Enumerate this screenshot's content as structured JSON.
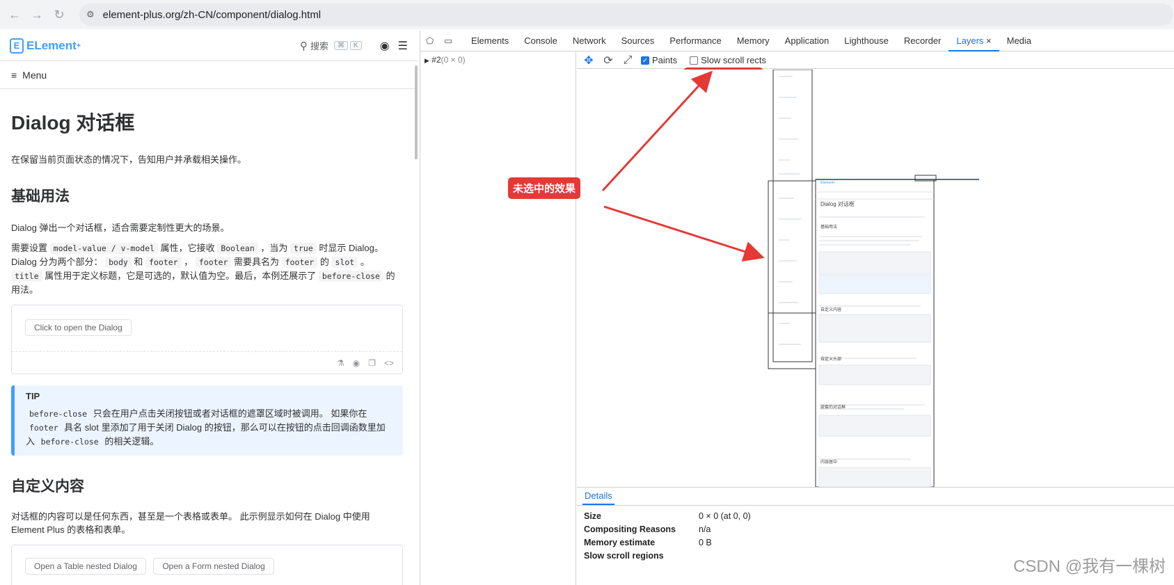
{
  "browser": {
    "url": "element-plus.org/zh-CN/component/dialog.html"
  },
  "page": {
    "logo_text": "ELement",
    "logo_sup": "+",
    "search_label": "搜索",
    "kbd1": "⌘",
    "kbd2": "K",
    "menu_label": "Menu",
    "title": "Dialog 对话框",
    "intro": "在保留当前页面状态的情况下，告知用户并承载相关操作。",
    "section1": "基础用法",
    "s1_p1": "Dialog 弹出一个对话框，适合需要定制性更大的场景。",
    "s1_p2_a": "需要设置",
    "s1_p2_code1": "model-value / v-model",
    "s1_p2_b": "属性，它接收",
    "s1_p2_code2": "Boolean",
    "s1_p2_c": "，当为",
    "s1_p2_code3": "true",
    "s1_p2_d": "时显示 Dialog。Dialog 分为两个部分：",
    "s1_p2_code4": "body",
    "s1_p2_e": "和",
    "s1_p2_code5": "footer",
    "s1_p2_f": "，",
    "s1_p2_code6": "footer",
    "s1_p2_g": "需要具名为",
    "s1_p2_code7": "footer",
    "s1_p2_h": "的",
    "s1_p2_code8": "slot",
    "s1_p2_i": "。",
    "s1_p2_code9": "title",
    "s1_p2_j": "属性用于定义标题，它是可选的，默认值为空。最后，本例还展示了",
    "s1_p2_code10": "before-close",
    "s1_p2_k": "的用法。",
    "demo1_button": "Click to open the Dialog",
    "tip_title": "TIP",
    "tip_code1": "before-close",
    "tip_a": "只会在用户点击关闭按钮或者对话框的遮罩区域时被调用。 如果你在",
    "tip_code2": "footer",
    "tip_b": "具名 slot 里添加了用于关闭 Dialog 的按钮，那么可以在按钮的点击回调函数里加入",
    "tip_code3": "before-close",
    "tip_c": "的相关逻辑。",
    "section2": "自定义内容",
    "s2_p1": "对话框的内容可以是任何东西，甚至是一个表格或表单。 此示例显示如何在 Dialog 中使用 Element Plus 的表格和表单。",
    "demo2_button1": "Open a Table nested Dialog",
    "demo2_button2": "Open a Form nested Dialog"
  },
  "devtools": {
    "tabs": [
      "Elements",
      "Console",
      "Network",
      "Sources",
      "Performance",
      "Memory",
      "Application",
      "Lighthouse",
      "Recorder",
      "Layers",
      "Media"
    ],
    "active_tab": "Layers",
    "tree_node": "#2",
    "tree_node_size": "(0 × 0)",
    "paints_label": "Paints",
    "paints_checked": true,
    "slow_scroll_label": "Slow scroll rects",
    "slow_scroll_checked": false,
    "details_tab": "Details",
    "details": [
      {
        "key": "Size",
        "value": "0 × 0 (at 0, 0)"
      },
      {
        "key": "Compositing Reasons",
        "value": "n/a"
      },
      {
        "key": "Memory estimate",
        "value": "0 B"
      },
      {
        "key": "Slow scroll regions",
        "value": ""
      }
    ]
  },
  "annotation": {
    "callout": "未选中的效果",
    "color": "#e53935"
  },
  "watermark": "CSDN @我有一棵树",
  "mini_page": {
    "logo": "Element+",
    "title": "Dialog 对话框",
    "sec1": "基础用法",
    "sec2": "自定义内容",
    "sec3": "自定义头部",
    "sec4": "嵌套的对话框",
    "sec5": "内容居中"
  }
}
